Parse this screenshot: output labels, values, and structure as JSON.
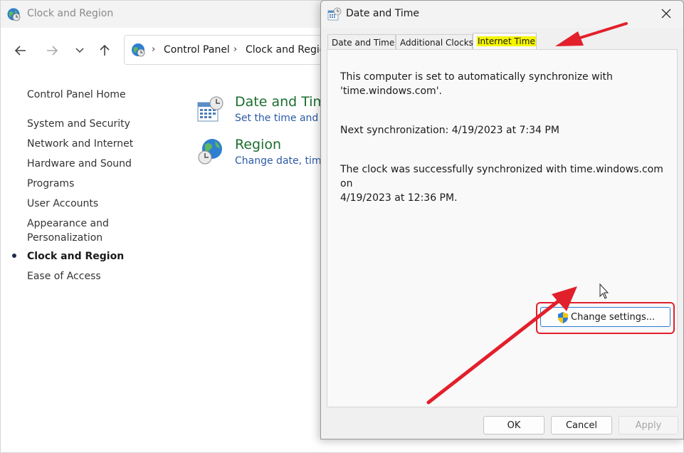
{
  "control_panel": {
    "title": "Clock and Region",
    "address": {
      "segments": [
        "Control Panel",
        "Clock and Regio"
      ]
    },
    "sidebar": {
      "home": "Control Panel Home",
      "items": [
        "System and Security",
        "Network and Internet",
        "Hardware and Sound",
        "Programs",
        "User Accounts",
        "Appearance and",
        "Personalization",
        "Clock and Region",
        "Ease of Access"
      ]
    },
    "categories": [
      {
        "title": "Date and Time",
        "subtitle": "Set the time and d"
      },
      {
        "title": "Region",
        "subtitle": "Change date, time"
      }
    ]
  },
  "dialog": {
    "title": "Date and Time",
    "tabs": [
      "Date and Time",
      "Additional Clocks",
      "Internet Time"
    ],
    "active_tab": "Internet Time",
    "sync_line1": "This computer is set to automatically synchronize with",
    "sync_line2": "'time.windows.com'.",
    "next_sync": "Next synchronization: 4/19/2023 at 7:34 PM",
    "result_line1": "The clock was successfully synchronized with time.windows.com on",
    "result_line2": "4/19/2023 at 12:36 PM.",
    "change_settings": "Change settings...",
    "ok": "OK",
    "cancel": "Cancel",
    "apply": "Apply"
  },
  "colors": {
    "highlight": "#f5f500",
    "annotation_red": "#e2202b",
    "category_title": "#1b6e2e",
    "category_link": "#2b5aa6"
  },
  "icons": [
    "globe-clock-icon",
    "back-arrow-icon",
    "forward-arrow-icon",
    "chevron-down-icon",
    "up-arrow-icon",
    "calendar-clock-icon",
    "globe-icon",
    "close-icon",
    "shield-icon",
    "mouse-cursor-icon"
  ]
}
